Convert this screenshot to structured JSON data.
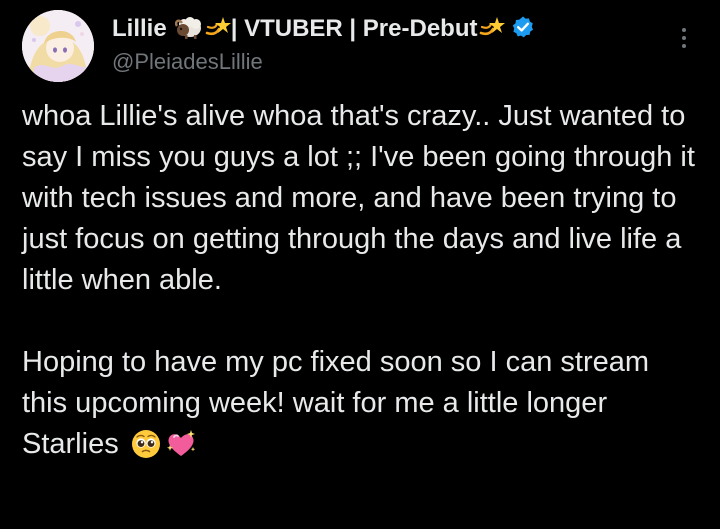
{
  "author": {
    "display_name_start": "Lillie",
    "display_name_mid": " | VTUBER | Pre-Debut",
    "handle": "@PleiadesLillie",
    "icons": [
      "ram-icon",
      "shooting-star-icon",
      "shooting-star-icon",
      "verified-badge-icon"
    ],
    "verified_color": "#1d9bf0"
  },
  "menu": {
    "icon": "more-vertical-icon"
  },
  "tweet": {
    "paragraph_1": "whoa Lillie's alive whoa that's crazy.. Just wanted to say I miss you guys a lot ;; I've been going through it with tech issues and more, and have been trying to just focus on getting through the days and live life a little when able.",
    "paragraph_2": "Hoping to have my pc fixed soon so I can stream this upcoming week! wait for me a little longer Starlies",
    "trailing_emoji": [
      "pleading-face-icon",
      "sparkling-heart-icon"
    ]
  },
  "colors": {
    "background": "#000000",
    "text": "#e7e9ea",
    "secondary_text": "#71767b"
  }
}
